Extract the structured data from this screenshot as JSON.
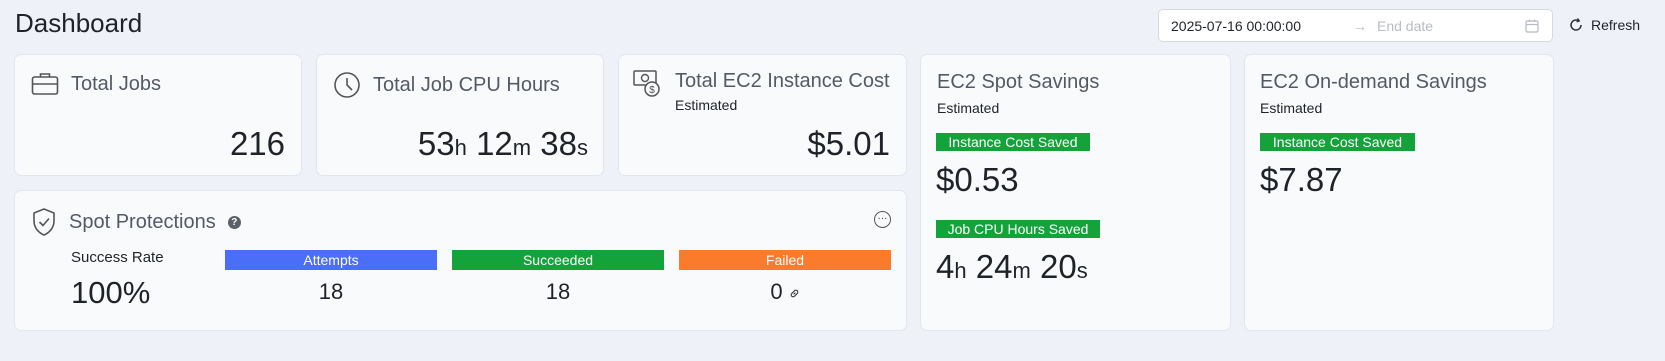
{
  "page": {
    "title": "Dashboard"
  },
  "toolbar": {
    "start_date": "2025-07-16 00:00:00",
    "end_placeholder": "End date",
    "arrow": "→",
    "refresh_label": "Refresh"
  },
  "cards": {
    "total_jobs": {
      "title": "Total Jobs",
      "value": "216"
    },
    "cpu_hours": {
      "title": "Total Job CPU Hours",
      "h": "53",
      "m": "12",
      "s": "38",
      "h_unit": "h",
      "m_unit": "m",
      "s_unit": "s"
    },
    "ec2_cost": {
      "title": "Total EC2 Instance Cost",
      "subtitle": "Estimated",
      "value": "$5.01"
    },
    "spot_savings": {
      "title": "EC2 Spot Savings",
      "subtitle": "Estimated",
      "cost_badge": "Instance Cost Saved",
      "cost_value": "$0.53",
      "hours_badge": "Job CPU Hours Saved",
      "h": "4",
      "m": "24",
      "s": "20",
      "h_unit": "h",
      "m_unit": "m",
      "s_unit": "s"
    },
    "ondemand_savings": {
      "title": "EC2 On-demand Savings",
      "subtitle": "Estimated",
      "cost_badge": "Instance Cost Saved",
      "cost_value": "$7.87"
    },
    "spot_protections": {
      "title": "Spot Protections",
      "help": "?",
      "more": "···",
      "success_label": "Success Rate",
      "success_value": "100%",
      "attempts_label": "Attempts",
      "attempts_value": "18",
      "succeeded_label": "Succeeded",
      "succeeded_value": "18",
      "failed_label": "Failed",
      "failed_value": "0"
    }
  },
  "colors": {
    "green": "#13a33a",
    "blue": "#4a6ef7",
    "orange": "#fa7b2c"
  }
}
